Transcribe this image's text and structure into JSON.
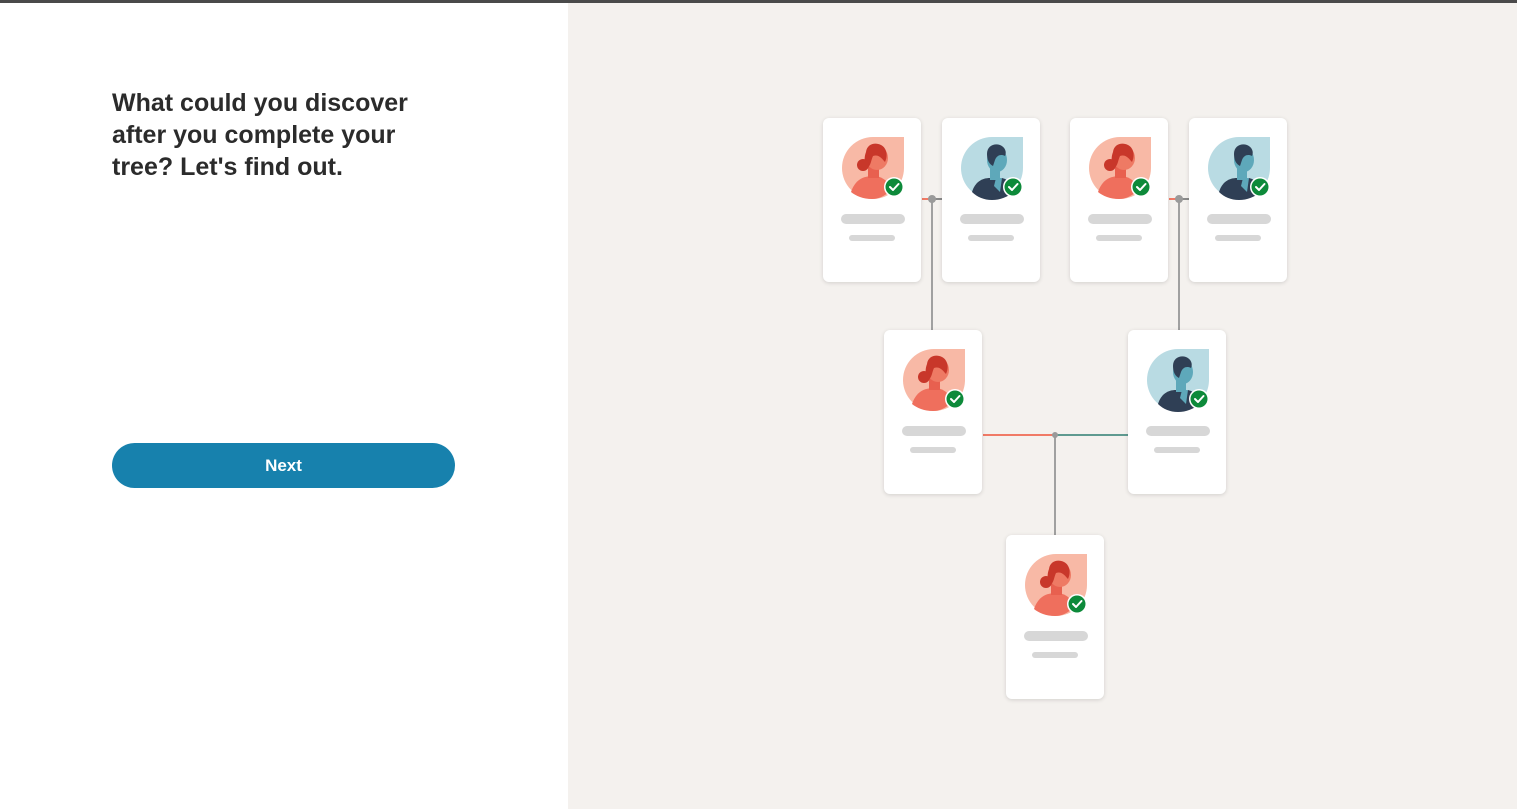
{
  "left": {
    "heading": "What could you discover after you complete your tree? Let's find out.",
    "next_label": "Next"
  },
  "colors": {
    "button": "#1781ad",
    "illustration_bg": "#f4f1ee",
    "female_bg": "#f8b9a6",
    "male_bg": "#b9dbe3",
    "check": "#0d8a3a",
    "maternal_line": "#f07a66",
    "paternal_line": "#5f9a90",
    "connector": "#a0a0a0"
  },
  "tree": {
    "cards": [
      {
        "id": "grandmother-1",
        "gender": "female",
        "verified": true
      },
      {
        "id": "grandfather-1",
        "gender": "male",
        "verified": true
      },
      {
        "id": "grandmother-2",
        "gender": "female",
        "verified": true
      },
      {
        "id": "grandfather-2",
        "gender": "male",
        "verified": true
      },
      {
        "id": "mother",
        "gender": "female",
        "verified": true
      },
      {
        "id": "father",
        "gender": "male",
        "verified": true
      },
      {
        "id": "self",
        "gender": "female",
        "verified": true
      }
    ]
  }
}
